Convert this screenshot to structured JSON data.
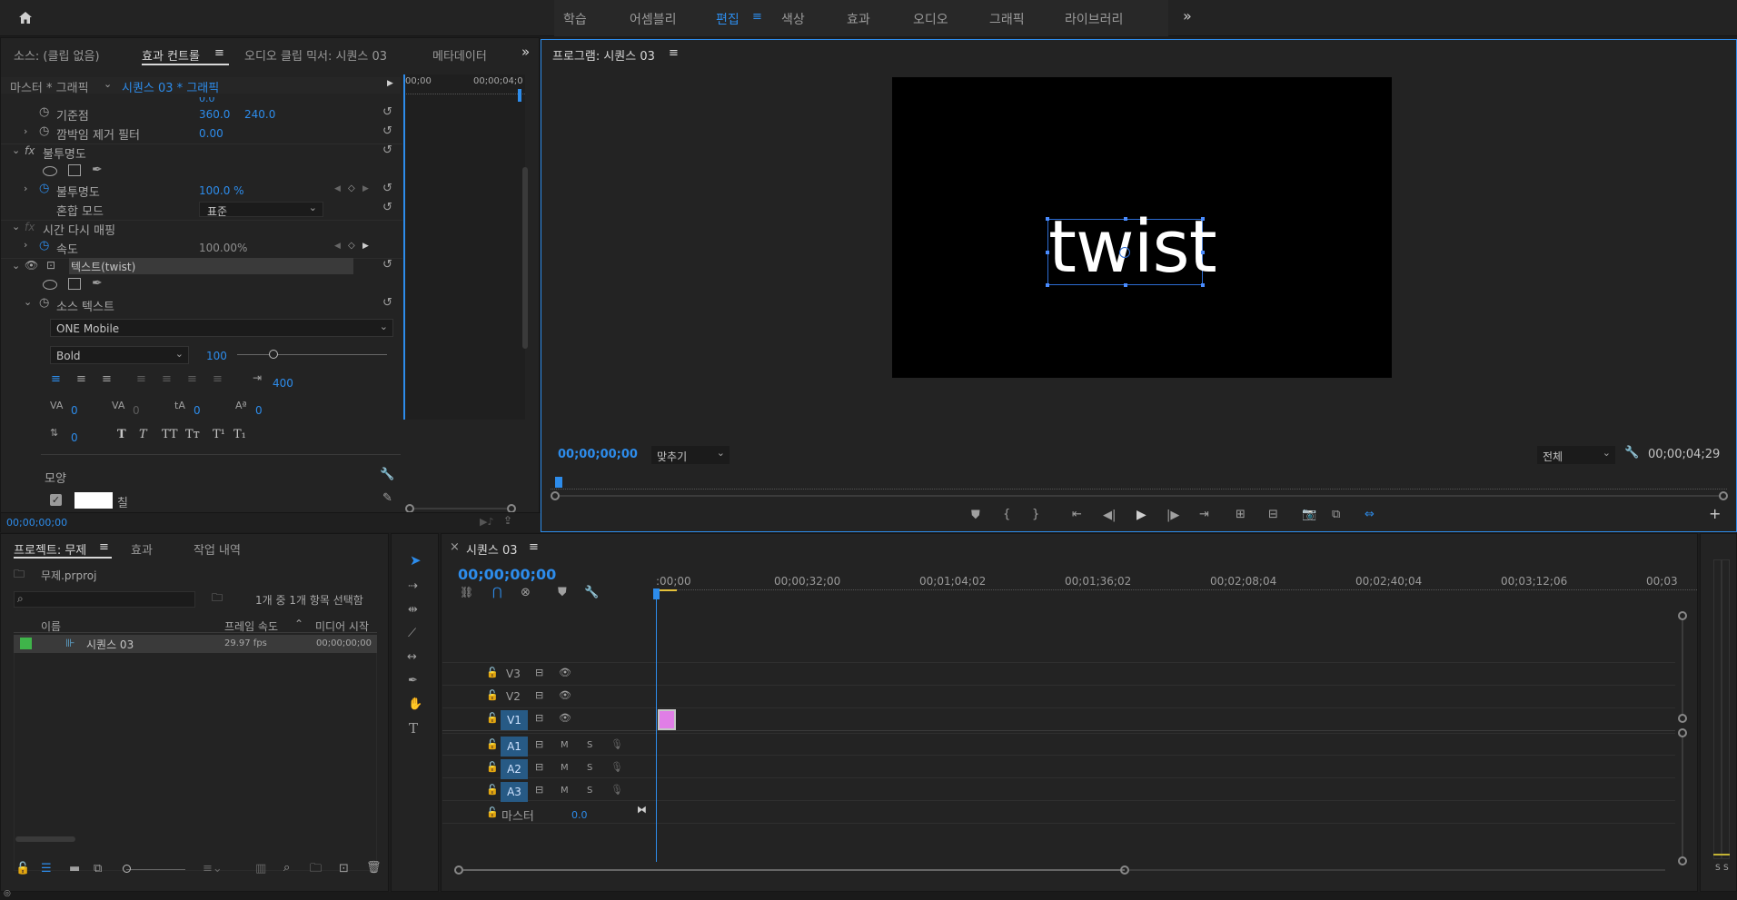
{
  "workspace": {
    "tabs": [
      "학습",
      "어셈블리",
      "편집",
      "색상",
      "효과",
      "오디오",
      "그래픽",
      "라이브러리"
    ],
    "active_index": 2,
    "more": "»"
  },
  "effect_controls": {
    "tabs": [
      "소스: (클립 없음)",
      "효과 컨트롤",
      "오디오 클립 믹서: 시퀀스 03",
      "메타데이터"
    ],
    "more": "»",
    "master_label": "마스터 * 그래픽",
    "sequence_label": "시퀀스 03 * 그래픽",
    "ruler": {
      "start": "00;00",
      "end": "00;00;04;0"
    },
    "rows": {
      "scale_partial_value": "0.0",
      "anchor_label": "기준점",
      "anchor_x": "360.0",
      "anchor_y": "240.0",
      "flicker_label": "깜박임 제거 필터",
      "flicker_value": "0.00",
      "opacity_group": "불투명도",
      "opacity_label": "불투명도",
      "opacity_value": "100.0 %",
      "blend_label": "혼합 모드",
      "blend_value": "표준",
      "time_remap_group": "시간 다시 매핑",
      "speed_label": "속도",
      "speed_value": "100.00%",
      "text_layer": "텍스트(twist)",
      "source_text": "소스 텍스트",
      "font_family": "ONE Mobile",
      "font_style": "Bold",
      "font_size": "100",
      "tracking_value": "400",
      "kerning": "0",
      "tracking2": "0",
      "leading": "0",
      "baseline": "0",
      "tsume": "0",
      "text_styles": [
        "T",
        "T",
        "TT",
        "Tт",
        "T¹",
        "T₁"
      ],
      "appearance": "모양",
      "fill_label": "칠",
      "fill_color": "#ffffff"
    },
    "timecode": "00;00;00;00"
  },
  "program": {
    "title": "프로그램: 시퀀스 03",
    "menu": "≡",
    "text": "twist",
    "timecode": "00;00;00;00",
    "fit": "맞추기",
    "quality": "전체",
    "duration": "00;00;04;29"
  },
  "project": {
    "tabs": [
      "프로젝트: 무제",
      "효과",
      "작업 내역"
    ],
    "file": "무제.prproj",
    "selection": "1개 중 1개 항목 선택함",
    "columns": [
      "이름",
      "프레임 속도",
      "미디어 시작"
    ],
    "items": [
      {
        "name": "시퀀스 03",
        "fps": "29.97 fps",
        "start": "00;00;00;00",
        "label_color": "#3fb44a"
      }
    ]
  },
  "timeline": {
    "close": "×",
    "title": "시퀀스 03",
    "menu": "≡",
    "timecode": "00;00;00;00",
    "ruler": [
      ":00;00",
      "00;00;32;00",
      "00;01;04;02",
      "00;01;36;02",
      "00;02;08;04",
      "00;02;40;04",
      "00;03;12;06",
      "00;03"
    ],
    "video_tracks": [
      "V3",
      "V2",
      "V1"
    ],
    "audio_tracks": [
      "A1",
      "A2",
      "A3"
    ],
    "mute": "M",
    "solo": "S",
    "master_label": "마스터",
    "master_value": "0.0",
    "clip_color": "#e07ee6"
  },
  "audio_meter": {
    "labels": [
      "S",
      "S"
    ]
  }
}
